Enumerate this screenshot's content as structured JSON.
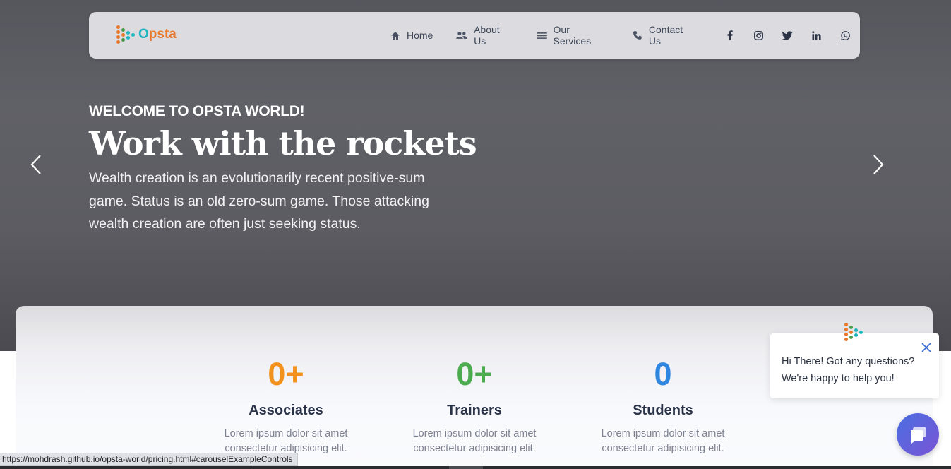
{
  "brand": {
    "name": "Opsta",
    "colors": {
      "orange": "#e8782a",
      "teal": "#1fb4bf",
      "green": "#4a9a4e"
    }
  },
  "nav": {
    "items": [
      {
        "label": "Home",
        "icon": "home-icon"
      },
      {
        "label": "About Us",
        "icon": "people-icon"
      },
      {
        "label": "Our Services",
        "icon": "menu-icon"
      },
      {
        "label": "Contact Us",
        "icon": "phone-icon"
      }
    ],
    "social": [
      "facebook-icon",
      "instagram-icon",
      "twitter-icon",
      "linkedin-icon",
      "whatsapp-icon"
    ]
  },
  "hero": {
    "kicker": "WELCOME TO OPSTA WORLD!",
    "title": "Work with the rockets",
    "description": "Wealth creation is an evolutionarily recent positive-sum game. Status is an old zero-sum game. Those attacking wealth creation are often just seeking status.",
    "prev_icon": "chevron-left-icon",
    "next_icon": "chevron-right-icon"
  },
  "stats": [
    {
      "value": "0+",
      "label": "Associates",
      "desc": "Lorem ipsum dolor sit amet consectetur adipisicing elit.",
      "color": "#f2911b"
    },
    {
      "value": "0+",
      "label": "Trainers",
      "desc": "Lorem ipsum dolor sit amet consectetur adipisicing elit.",
      "color": "#4caa4f"
    },
    {
      "value": "0",
      "label": "Students",
      "desc": "Lorem ipsum dolor sit amet consectetur adipisicing elit.",
      "color": "#2f86e0"
    }
  ],
  "chat": {
    "line1": "Hi There! Got any questions?",
    "line2": "We're happy to help you!"
  },
  "status_bar": {
    "url": "https://mohdrash.github.io/opsta-world/pricing.html#carouselExampleControls"
  }
}
